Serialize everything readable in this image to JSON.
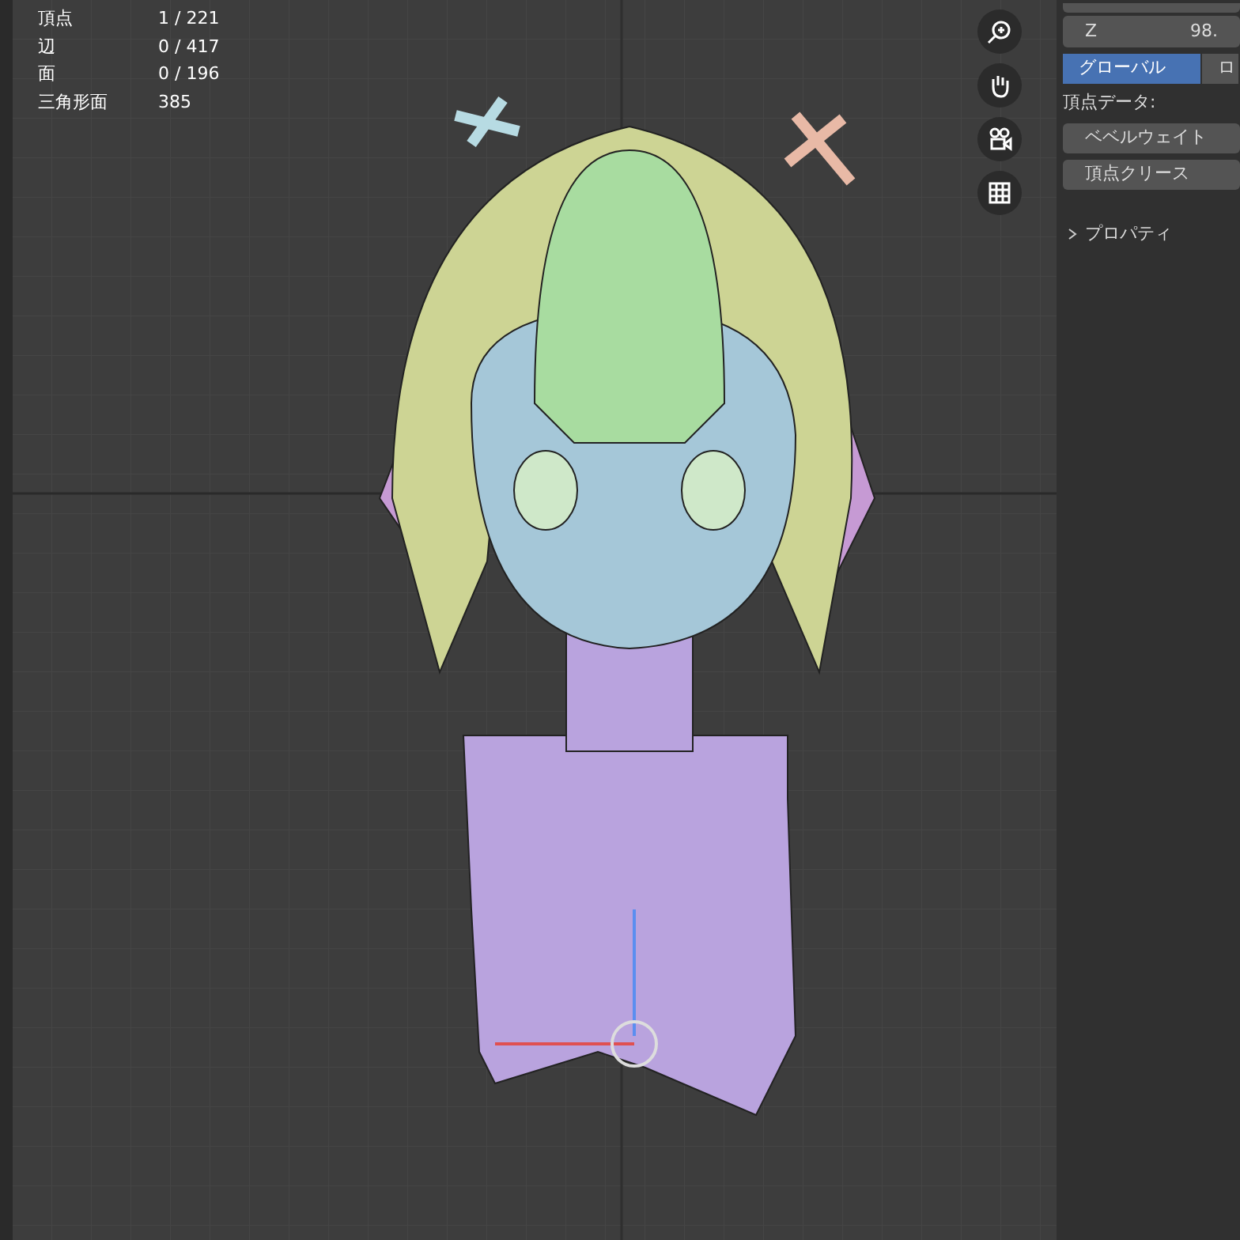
{
  "stats": [
    {
      "label": "頂点",
      "value": "1 / 221"
    },
    {
      "label": "辺",
      "value": "0 / 417"
    },
    {
      "label": "面",
      "value": "0 / 196"
    },
    {
      "label": "三角形面",
      "value": "385"
    }
  ],
  "panel": {
    "rows": [
      {
        "label": "Z",
        "value": "98."
      }
    ],
    "tabs": [
      {
        "label": "グローバル",
        "selected": true
      },
      {
        "label": "ロ",
        "selected": false
      }
    ],
    "section_label": "頂点データ:",
    "buttons": [
      "ベベルウェイト",
      "頂点クリース"
    ],
    "subpanel": {
      "label": "プロパティ",
      "expanded": false
    }
  }
}
